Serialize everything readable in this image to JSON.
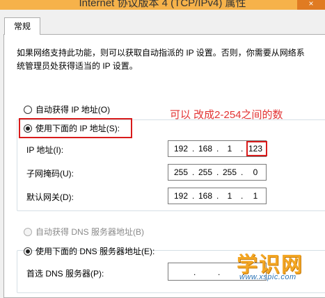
{
  "window": {
    "title": "Internet 协议版本 4 (TCP/IPv4) 属性",
    "close_symbol": "×"
  },
  "tabs": [
    {
      "label": "常规",
      "selected": true
    }
  ],
  "description": "如果网络支持此功能，则可以获取自动指派的 IP 设置。否则，你需要从网络系统管理员处获得适当的 IP 设置。",
  "ip_mode": {
    "auto_label": "自动获得 IP 地址(O)",
    "auto_selected": false,
    "manual_label": "使用下面的 IP 地址(S):",
    "manual_selected": true
  },
  "ip_fields": {
    "ip_address": {
      "label": "IP 地址(I):",
      "octets": [
        "192",
        "168",
        "1",
        "123"
      ]
    },
    "subnet_mask": {
      "label": "子网掩码(U):",
      "octets": [
        "255",
        "255",
        "255",
        "0"
      ]
    },
    "default_gateway": {
      "label": "默认网关(D):",
      "octets": [
        "192",
        "168",
        "1",
        "1"
      ]
    }
  },
  "dns_mode": {
    "auto_label": "自动获得 DNS 服务器地址(B)",
    "auto_enabled": false,
    "manual_label": "使用下面的 DNS 服务器地址(E):",
    "manual_selected": true
  },
  "dns_fields": {
    "preferred": {
      "label": "首选 DNS 服务器(P):",
      "octets": [
        "",
        "",
        "",
        ""
      ]
    }
  },
  "annotation": {
    "text": "可以 改成2-254之间的数",
    "color": "#e23333"
  },
  "watermark": {
    "main": "学识网",
    "sub": "www.xspic.com"
  },
  "colors": {
    "highlight": "#d81b1b",
    "title_bar": "#f6b24a"
  }
}
